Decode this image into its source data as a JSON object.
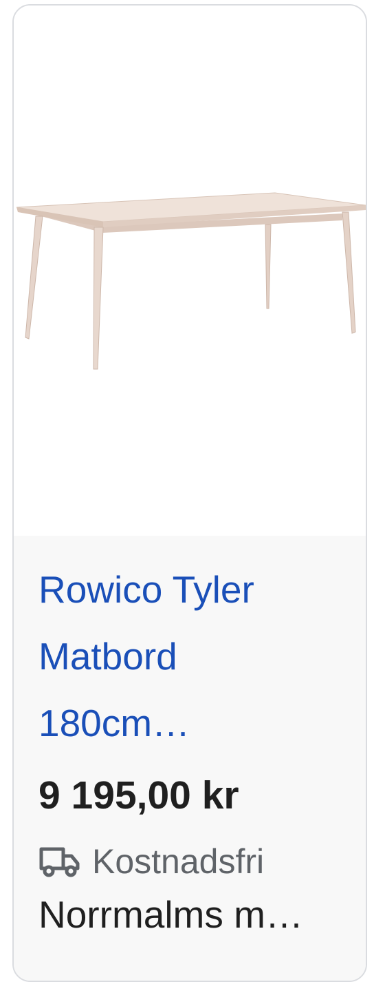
{
  "product": {
    "image_alt": "wooden-dining-table",
    "title_lines": [
      "Rowico Tyler",
      "Matbord",
      "180cm…"
    ],
    "price": "9 195,00 kr",
    "shipping": {
      "icon": "truck-icon",
      "label": "Kostnadsfri"
    },
    "seller": "Norrmalms m…"
  },
  "colors": {
    "title": "#1a4fb8",
    "price": "#1f1f1f",
    "shipping": "#5f6368",
    "info_background": "#f8f8f8",
    "card_border": "#dadce0"
  }
}
